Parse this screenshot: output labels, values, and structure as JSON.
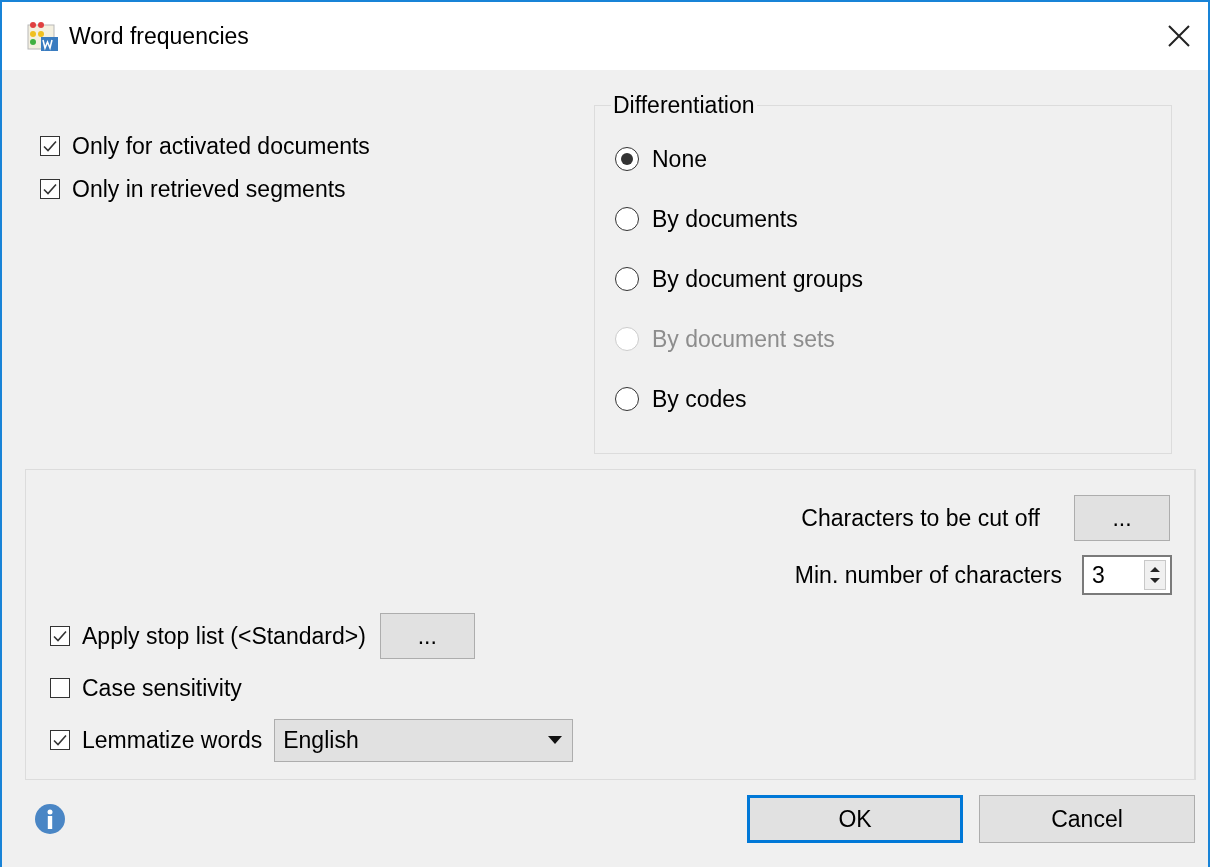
{
  "window": {
    "title": "Word frequencies"
  },
  "options": [
    {
      "label": "Only for activated documents",
      "checked": true
    },
    {
      "label": "Only in retrieved segments",
      "checked": true
    }
  ],
  "differentiation": {
    "title": "Differentiation",
    "options": [
      {
        "label": "None",
        "selected": true,
        "disabled": false
      },
      {
        "label": "By documents",
        "selected": false,
        "disabled": false
      },
      {
        "label": "By document groups",
        "selected": false,
        "disabled": false
      },
      {
        "label": "By document sets",
        "selected": false,
        "disabled": true
      },
      {
        "label": "By codes",
        "selected": false,
        "disabled": false
      }
    ]
  },
  "settings": {
    "cut_off_label": "Characters to be cut off",
    "cut_off_button": "...",
    "min_chars_label": "Min. number of characters",
    "min_chars_value": "3",
    "stop_list": {
      "label": "Apply stop list (<Standard>)",
      "checked": true,
      "button": "..."
    },
    "case_sensitivity": {
      "label": "Case sensitivity",
      "checked": false
    },
    "lemmatize": {
      "label": "Lemmatize words",
      "checked": true,
      "language": "English"
    }
  },
  "buttons": [
    {
      "label": "OK",
      "default": true
    },
    {
      "label": "Cancel",
      "default": false
    }
  ]
}
